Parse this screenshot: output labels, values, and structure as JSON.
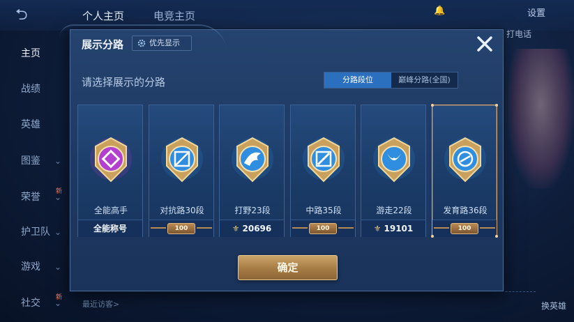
{
  "background": {
    "tabs": [
      "个人主页",
      "电竞主页"
    ],
    "top_right": {
      "settings": "设置"
    },
    "sidebar": [
      {
        "label": "主页",
        "active": true,
        "chevron": false,
        "new": false
      },
      {
        "label": "战绩",
        "active": false,
        "chevron": false,
        "new": false
      },
      {
        "label": "英雄",
        "active": false,
        "chevron": false,
        "new": false
      },
      {
        "label": "图鉴",
        "active": false,
        "chevron": true,
        "new": false
      },
      {
        "label": "荣誉",
        "active": false,
        "chevron": true,
        "new": true
      },
      {
        "label": "护卫队",
        "active": false,
        "chevron": true,
        "new": false
      },
      {
        "label": "游戏",
        "active": false,
        "chevron": true,
        "new": false
      },
      {
        "label": "社交",
        "active": false,
        "chevron": true,
        "new": true
      }
    ],
    "new_badge": "新",
    "visitors_label": "最近访客>",
    "right_labels": [
      "打电话",
      "换英雄"
    ]
  },
  "modal": {
    "title": "展示分路",
    "priority_button": "优先显示",
    "subtitle": "请选择展示的分路",
    "segments": [
      {
        "label": "分路段位",
        "active": true
      },
      {
        "label": "巅峰分路(全国)",
        "active": false
      }
    ],
    "cards": [
      {
        "role": "全能高手",
        "footer": "全能称号",
        "footer_type": "text",
        "selected": false,
        "badge_color": "#b23fcf"
      },
      {
        "role": "对抗路30段",
        "footer": "100",
        "footer_type": "stars",
        "selected": false,
        "badge_color": "#2f8ee0"
      },
      {
        "role": "打野23段",
        "footer": "20696",
        "footer_type": "peak",
        "selected": false,
        "badge_color": "#2f8ee0"
      },
      {
        "role": "中路35段",
        "footer": "100",
        "footer_type": "stars",
        "selected": false,
        "badge_color": "#2f8ee0"
      },
      {
        "role": "游走22段",
        "footer": "19101",
        "footer_type": "peak",
        "selected": false,
        "badge_color": "#2f8ee0"
      },
      {
        "role": "发育路36段",
        "footer": "100",
        "footer_type": "stars",
        "selected": true,
        "badge_color": "#2f8ee0"
      }
    ],
    "confirm": "确定"
  },
  "colors": {
    "accent_blue": "#2b6fbf",
    "gold": "#caa56a",
    "selected_border": "#d9a56a"
  }
}
